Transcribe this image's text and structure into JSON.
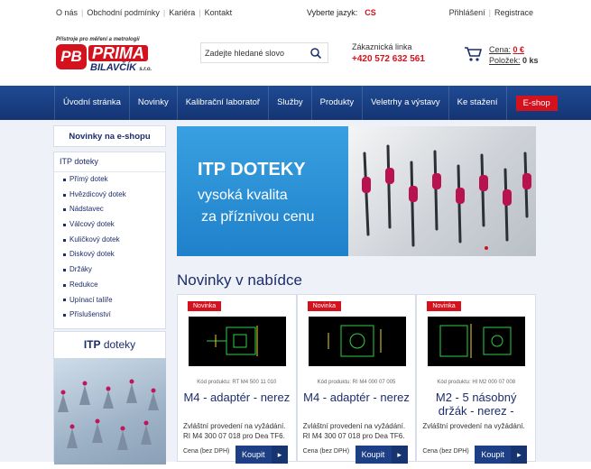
{
  "topbar": {
    "links": [
      "O nás",
      "Obchodní podmínky",
      "Kariéra",
      "Kontakt"
    ],
    "lang_label": "Vyberte jazyk:",
    "lang": "CS",
    "login": "Přihlášení",
    "register": "Registrace"
  },
  "header": {
    "logo_tagline": "Přístroje pro měření a metrologii",
    "logo_name": "PRIMA",
    "logo_sub": "BILAVČÍK",
    "logo_suffix": "s.r.o.",
    "search_placeholder": "Zadejte hledané slovo",
    "phone_label": "Zákaznická linka",
    "phone": "+420 572 632 561",
    "cart_price_label": "Cena:",
    "cart_price": "0 €",
    "cart_items_label": "Položek:",
    "cart_items": "0 ks"
  },
  "nav": [
    "Úvodní stránka",
    "Novinky",
    "Kalibrační laboratoř",
    "Služby",
    "Produkty",
    "Veletrhy a výstavy",
    "Ke stažení"
  ],
  "nav_shop": "E-shop",
  "sidebar": {
    "news": "Novinky na e-shopu",
    "category": "ITP doteky",
    "items": [
      "Přímý dotek",
      "Hvězdicový dotek",
      "Nádstavec",
      "Válcový dotek",
      "Kuličkový dotek",
      "Diskový dotek",
      "Držáky",
      "Redukce",
      "Upínací talíře",
      "Příslušenství"
    ],
    "promo_bold": "ITP",
    "promo_rest": "doteky"
  },
  "banner": {
    "line1": "ITP DOTEKY",
    "line2": "vysoká kvalita",
    "line3": "za příznivou cenu"
  },
  "section_title": "Novinky v nabídce",
  "products": [
    {
      "badge": "Novinka",
      "code": "Kód produktu: RT M4 500 11 010",
      "name": "M4 - adaptér - nerez",
      "desc": "Zvláštní provedení na vyžádání. RI M4 300 07 018 pro Dea TF6.",
      "price_label": "Cena (bez DPH)",
      "buy": "Koupit"
    },
    {
      "badge": "Novinka",
      "code": "Kód produktu: RI M4 000 07 005",
      "name": "M4 - adaptér - nerez",
      "desc": "Zvláštní provedení na vyžádání. RI M4 300 07 018 pro Dea TF6.",
      "price_label": "Cena (bez DPH)",
      "buy": "Koupit"
    },
    {
      "badge": "Novinka",
      "code": "Kód produktu: HI M2 000 07 008",
      "name": "M2 - 5 násobný držák - nerez -",
      "desc": "Zvláštní provedení na vyžádání.",
      "price_label": "Cena (bez DPH)",
      "buy": "Koupit"
    }
  ]
}
